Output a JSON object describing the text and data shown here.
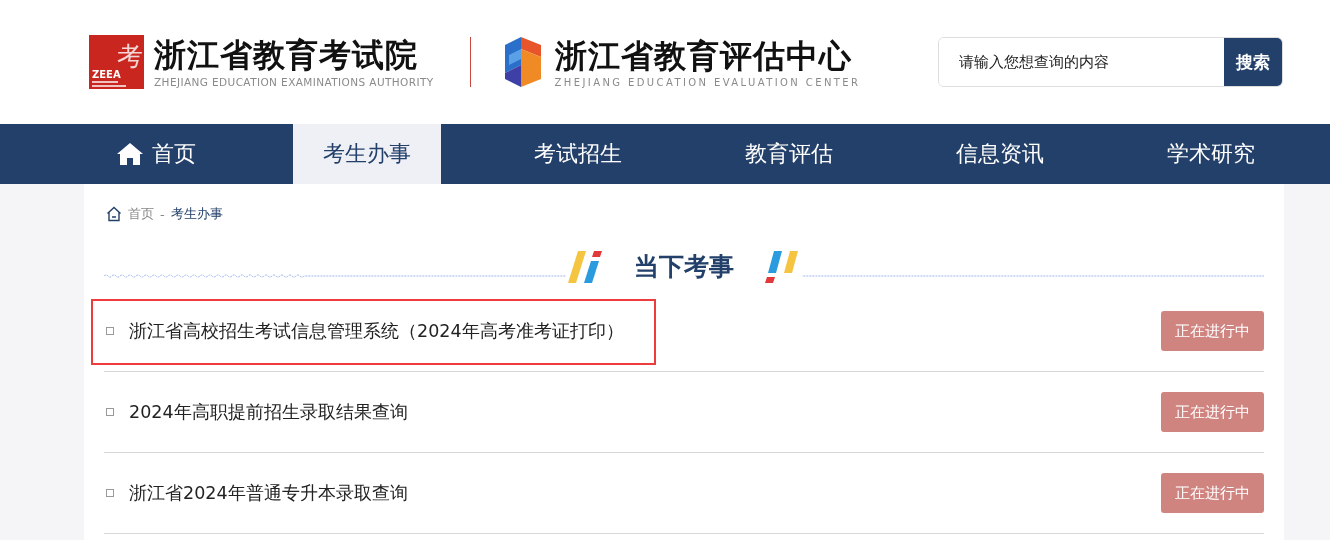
{
  "header": {
    "logo_mark": "考",
    "logo_abbr": "ZEEA",
    "org1": {
      "name": "浙江省教育考试院",
      "subtitle": "ZHEJIANG EDUCATION EXAMINATIONS AUTHORITY"
    },
    "org2": {
      "name": "浙江省教育评估中心",
      "subtitle": "ZHEJIANG EDUCATION EVALUATION CENTER"
    },
    "search": {
      "placeholder": "请输入您想查询的内容",
      "button": "搜索"
    }
  },
  "nav": [
    {
      "label": "首页",
      "kind": "home",
      "selected": false
    },
    {
      "label": "考生办事",
      "kind": "text",
      "selected": true
    },
    {
      "label": "考试招生",
      "kind": "text",
      "selected": false
    },
    {
      "label": "教育评估",
      "kind": "text",
      "selected": false
    },
    {
      "label": "信息资讯",
      "kind": "text",
      "selected": false
    },
    {
      "label": "学术研究",
      "kind": "text",
      "selected": false
    }
  ],
  "breadcrumb": [
    "首页",
    "-",
    "考生办事"
  ],
  "section_title": "当下考事",
  "items": [
    {
      "title": "浙江省高校招生考试信息管理系统（2024年高考准考证打印）",
      "status": "正在进行中",
      "highlighted": true
    },
    {
      "title": "2024年高职提前招生录取结果查询",
      "status": "正在进行中",
      "highlighted": false
    },
    {
      "title": "浙江省2024年普通专升本录取查询",
      "status": "正在进行中",
      "highlighted": false
    }
  ]
}
